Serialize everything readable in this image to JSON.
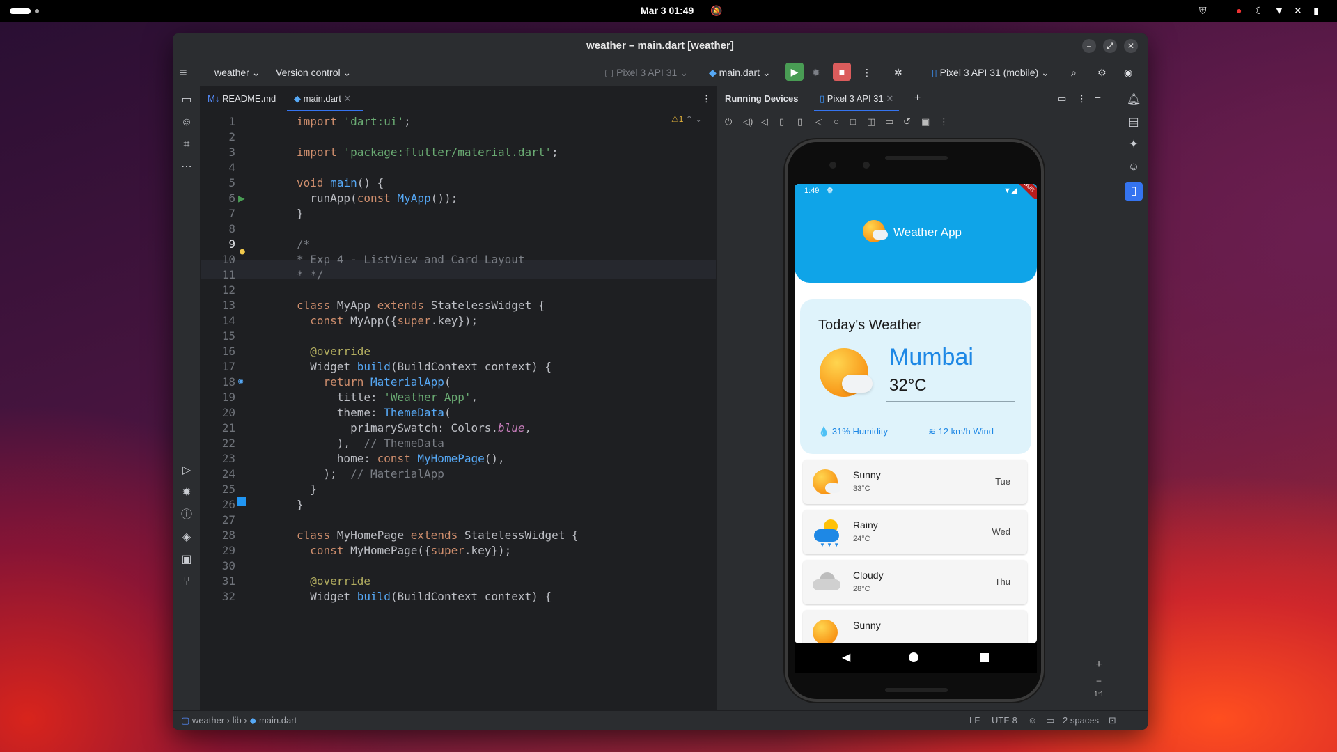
{
  "topbar": {
    "clock": "Mar 3  01:49"
  },
  "window": {
    "title": "weather – main.dart [weather]"
  },
  "toolbar": {
    "project": "weather",
    "vcs": "Version control",
    "device_selector_muted": "Pixel 3 API 31",
    "run_config": "main.dart",
    "device": "Pixel 3 API 31 (mobile)"
  },
  "editor": {
    "tabs": [
      {
        "label": "README.md",
        "icon": "markdown-icon"
      },
      {
        "label": "main.dart",
        "icon": "dart-icon"
      }
    ],
    "warnings": "1",
    "lines": [
      "1",
      "2",
      "3",
      "4",
      "5",
      "6",
      "7",
      "8",
      "9",
      "10",
      "11",
      "12",
      "13",
      "14",
      "15",
      "16",
      "17",
      "18",
      "19",
      "20",
      "21",
      "22",
      "23",
      "24",
      "25",
      "26",
      "27",
      "28",
      "29",
      "30",
      "31",
      "32"
    ]
  },
  "code": {
    "l1": {
      "kw": "import",
      "str": "'dart:ui'",
      "p": ";"
    },
    "l3": {
      "kw": "import",
      "str": "'package:flutter/material.dart'",
      "p": ";"
    },
    "l5": {
      "kw": "void",
      "fn": "main",
      "p": "() {"
    },
    "l6": {
      "a": "  runApp(",
      "kw": "const",
      "cls": "MyApp",
      "p": "());"
    },
    "l7": "}",
    "l9": "/*",
    "l10": "* Exp 4 - ListView and Card Layout",
    "l11": "* */",
    "l13": {
      "kw": "class",
      "a": "MyApp",
      "kw2": "extends",
      "b": "StatelessWidget {"
    },
    "l14": {
      "kw": "const",
      "a": "MyApp({",
      "kw2": "super",
      "b": ".key});"
    },
    "l16": "@override",
    "l17": {
      "a": "Widget",
      "fn": "build",
      "b": "(BuildContext context) {"
    },
    "l18": {
      "kw": "return",
      "cls": "MaterialApp",
      "p": "("
    },
    "l19": {
      "a": "title: ",
      "str": "'Weather App'",
      "p": ","
    },
    "l20": {
      "a": "theme: ",
      "cls": "ThemeData",
      "p": "("
    },
    "l21": {
      "a": "primarySwatch: Colors.",
      "it": "blue",
      "p": ","
    },
    "l22": {
      "a": "),",
      "cm": "// ThemeData"
    },
    "l23": {
      "a": "home: ",
      "kw": "const",
      "cls": "MyHomePage",
      "p": "(),"
    },
    "l24": {
      "a": ");",
      "cm": "// MaterialApp"
    },
    "l25": "}",
    "l26": "}",
    "l28": {
      "kw": "class",
      "a": "MyHomePage",
      "kw2": "extends",
      "b": "StatelessWidget {"
    },
    "l29": {
      "kw": "const",
      "a": "MyHomePage({",
      "kw2": "super",
      "b": ".key});"
    },
    "l31": "@override",
    "l32": {
      "a": "Widget",
      "fn": "build",
      "b": "(BuildContext context) {"
    }
  },
  "devices": {
    "panel_title": "Running Devices",
    "tab": "Pixel 3 API 31"
  },
  "app": {
    "time": "1:49",
    "debug_banner": "DEBUG",
    "title": "Weather App",
    "today_heading": "Today's Weather",
    "city": "Mumbai",
    "temp": "32°C",
    "humidity": "31% Humidity",
    "wind": "12 km/h Wind",
    "forecast": [
      {
        "cond": "Sunny",
        "temp": "33°C",
        "day": "Tue",
        "icon": "sun-cloud-icon"
      },
      {
        "cond": "Rainy",
        "temp": "24°C",
        "day": "Wed",
        "icon": "rain-cloud-icon"
      },
      {
        "cond": "Cloudy",
        "temp": "28°C",
        "day": "Thu",
        "icon": "cloud-icon"
      },
      {
        "cond": "Sunny",
        "temp": "",
        "day": "",
        "icon": "sun-cloud-icon"
      }
    ]
  },
  "zoom": {
    "ratio": "1:1"
  },
  "statusbar": {
    "crumb1": "weather",
    "crumb2": "lib",
    "crumb3": "main.dart",
    "le": "LF",
    "enc": "UTF-8",
    "indent": "2 spaces"
  },
  "colors": {
    "accent": "#3574f0",
    "app_blue": "#0fa4e8",
    "city_blue": "#1e88e5",
    "run_green": "#499c54",
    "stop_red": "#db5c5c"
  }
}
